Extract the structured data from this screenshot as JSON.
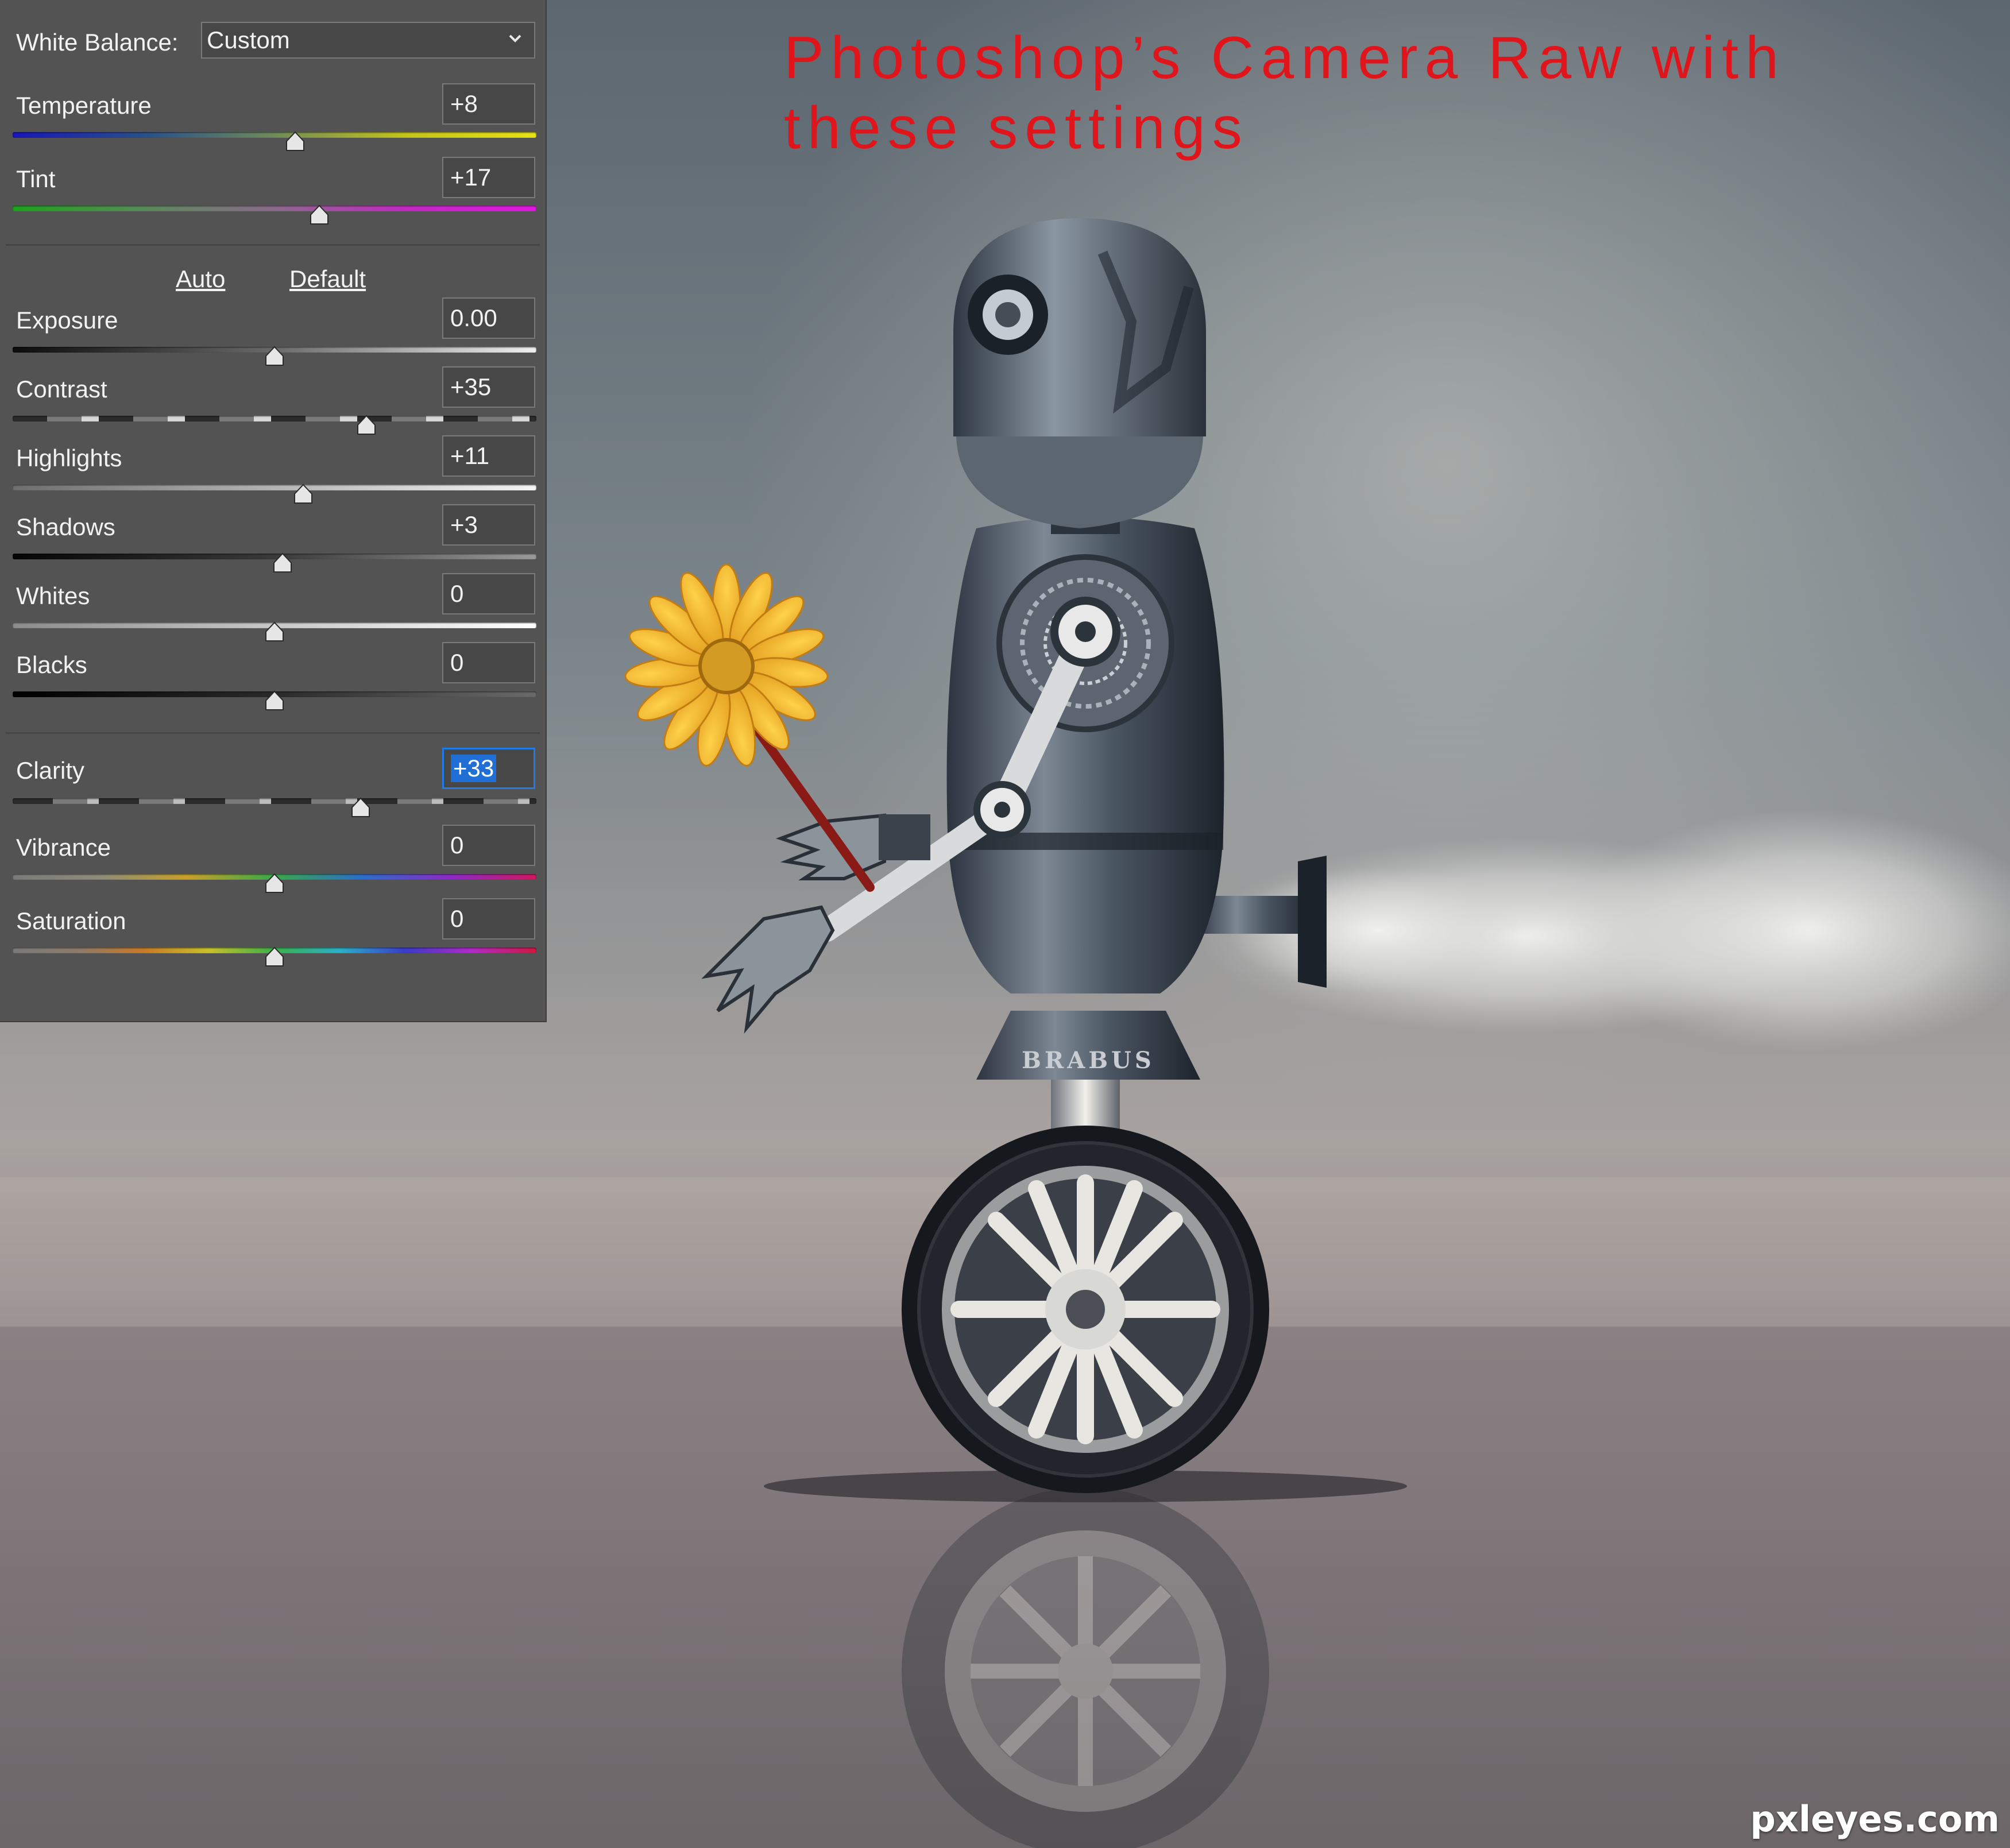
{
  "panel": {
    "white_balance": {
      "label": "White Balance:",
      "value": "Custom"
    },
    "tone_links": {
      "auto": "Auto",
      "default": "Default"
    },
    "sliders": {
      "temperature": {
        "label": "Temperature",
        "value": "+8",
        "position": 0.54
      },
      "tint": {
        "label": "Tint",
        "value": "+17",
        "position": 0.585
      },
      "exposure": {
        "label": "Exposure",
        "value": "0.00",
        "position": 0.5
      },
      "contrast": {
        "label": "Contrast",
        "value": "+35",
        "position": 0.675
      },
      "highlights": {
        "label": "Highlights",
        "value": "+11",
        "position": 0.555
      },
      "shadows": {
        "label": "Shadows",
        "value": "+3",
        "position": 0.515
      },
      "whites": {
        "label": "Whites",
        "value": "0",
        "position": 0.5
      },
      "blacks": {
        "label": "Blacks",
        "value": "0",
        "position": 0.5
      },
      "clarity": {
        "label": "Clarity",
        "value": "+33",
        "position": 0.665
      },
      "vibrance": {
        "label": "Vibrance",
        "value": "0",
        "position": 0.5
      },
      "saturation": {
        "label": "Saturation",
        "value": "0",
        "position": 0.5
      }
    }
  },
  "caption": {
    "line1": "Photoshop’s Camera Raw with",
    "line2": "these settings"
  },
  "robot": {
    "brand": "BRABUS"
  },
  "watermark": "pxleyes.com",
  "colors": {
    "caption_red": "#e0141b",
    "panel_bg": "#535353",
    "active_field": "#1f7be6",
    "flower": "#f3b62a"
  }
}
